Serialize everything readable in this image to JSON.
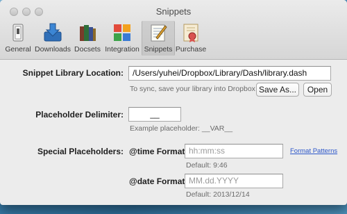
{
  "window": {
    "title": "Snippets"
  },
  "toolbar": {
    "items": [
      {
        "label": "General",
        "icon": "general-switch-icon"
      },
      {
        "label": "Downloads",
        "icon": "downloads-icon"
      },
      {
        "label": "Docsets",
        "icon": "docsets-books-icon"
      },
      {
        "label": "Integration",
        "icon": "integration-grid-icon"
      },
      {
        "label": "Snippets",
        "icon": "snippets-notepad-icon",
        "active": true
      },
      {
        "label": "Purchase",
        "icon": "purchase-certificate-icon"
      }
    ]
  },
  "library": {
    "label": "Snippet Library Location:",
    "path": "/Users/yuhei/Dropbox/Library/Dash/library.dash",
    "hint": "To sync, save your library into Dropbox",
    "save_as_label": "Save As...",
    "open_label": "Open"
  },
  "delimiter": {
    "label": "Placeholder Delimiter:",
    "value": "__",
    "hint": "Example placeholder: __VAR__"
  },
  "special": {
    "label": "Special Placeholders:",
    "time_label": "@time Format:",
    "time_placeholder": "hh:mm:ss",
    "time_default": "Default: 9:46",
    "format_patterns_label": "Format Patterns",
    "date_label": "@date Format:",
    "date_placeholder": "MM.dd.YYYY",
    "date_default": "Default: 2013/12/14"
  }
}
